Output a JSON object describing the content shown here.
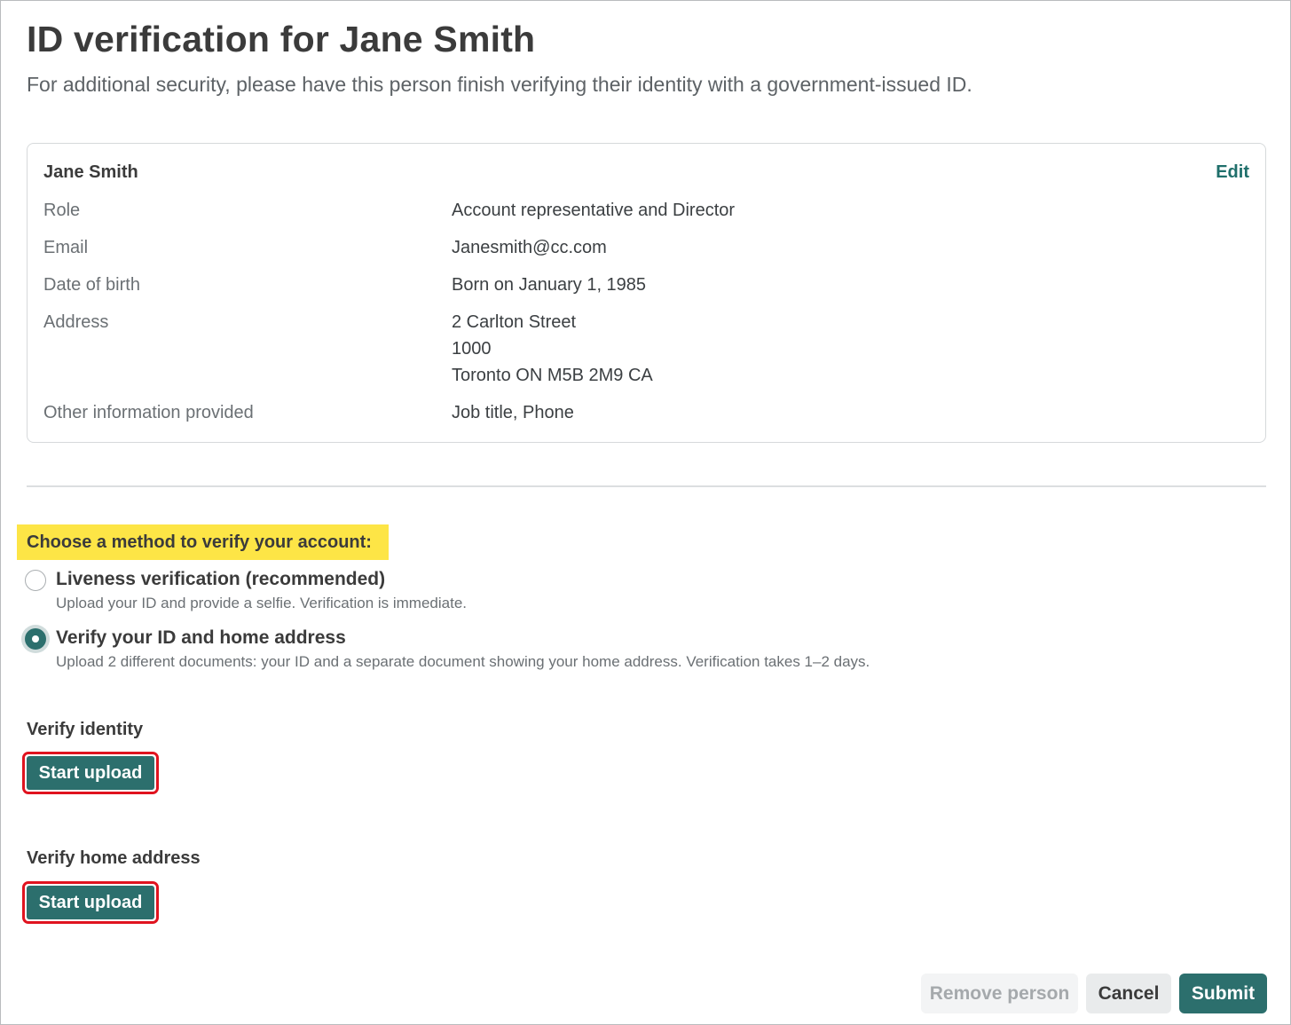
{
  "header": {
    "title": "ID verification for Jane Smith",
    "subtitle": "For additional security, please have this person finish verifying their identity with a government-issued ID."
  },
  "person_card": {
    "name": "Jane Smith",
    "edit_label": "Edit",
    "rows": [
      {
        "label": "Role",
        "value": "Account representative and Director"
      },
      {
        "label": "Email",
        "value": "Janesmith@cc.com"
      },
      {
        "label": "Date of birth",
        "value": "Born on January 1, 1985"
      },
      {
        "label": "Address",
        "value_lines": [
          "2 Carlton Street",
          "1000",
          "Toronto ON M5B 2M9 CA"
        ]
      },
      {
        "label": "Other information provided",
        "value": "Job title, Phone"
      }
    ]
  },
  "method": {
    "heading": "Choose a method to verify your account:",
    "highlight_color": "#fde546",
    "options": [
      {
        "title": "Liveness verification (recommended)",
        "description": "Upload your ID and provide a selfie. Verification is immediate.",
        "selected": false
      },
      {
        "title": "Verify your ID and home address",
        "description": "Upload 2 different documents: your ID and a separate document showing your home address. Verification takes 1–2 days.",
        "selected": true
      }
    ]
  },
  "uploads": {
    "identity": {
      "label": "Verify identity",
      "button": "Start upload"
    },
    "address": {
      "label": "Verify home address",
      "button": "Start upload"
    }
  },
  "footer": {
    "remove_label": "Remove person",
    "cancel_label": "Cancel",
    "submit_label": "Submit"
  },
  "colors": {
    "accent": "#2c6f6d",
    "annotation_outline": "#e0131f"
  }
}
